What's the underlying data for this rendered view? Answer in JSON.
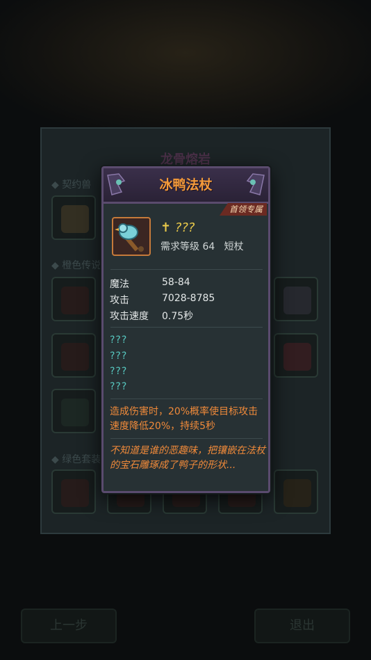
{
  "background": {
    "panel_title": "龙骨熔岩",
    "sections": [
      "契约兽",
      "橙色传说",
      "绿色套装"
    ],
    "buttons": {
      "prev": "上一步",
      "exit": "退出"
    }
  },
  "modal": {
    "title": "冰鸭法杖",
    "boss_tag": "首领专属",
    "item": {
      "icon": "ice-duck-staff-icon",
      "name": "???",
      "requirement_label": "需求等级 64",
      "type": "短杖"
    },
    "stats": [
      {
        "label": "魔法",
        "value": "58-84"
      },
      {
        "label": "攻击",
        "value": "7028-8785"
      },
      {
        "label": "攻击速度",
        "value": "0.75秒"
      }
    ],
    "unknown_stats": [
      "???",
      "???",
      "???",
      "???"
    ],
    "effect": "造成伤害时，20%概率使目标攻击速度降低20%，持续5秒",
    "flavor": "不知道是谁的恶趣味，把镶嵌在法杖的宝石雕琢成了鸭子的形状..."
  },
  "colors": {
    "title": "#f49a3a",
    "name": "#e8c84a",
    "unknown": "#57c8c0",
    "effect": "#f08a3a",
    "frame": "#5a4b6e"
  }
}
